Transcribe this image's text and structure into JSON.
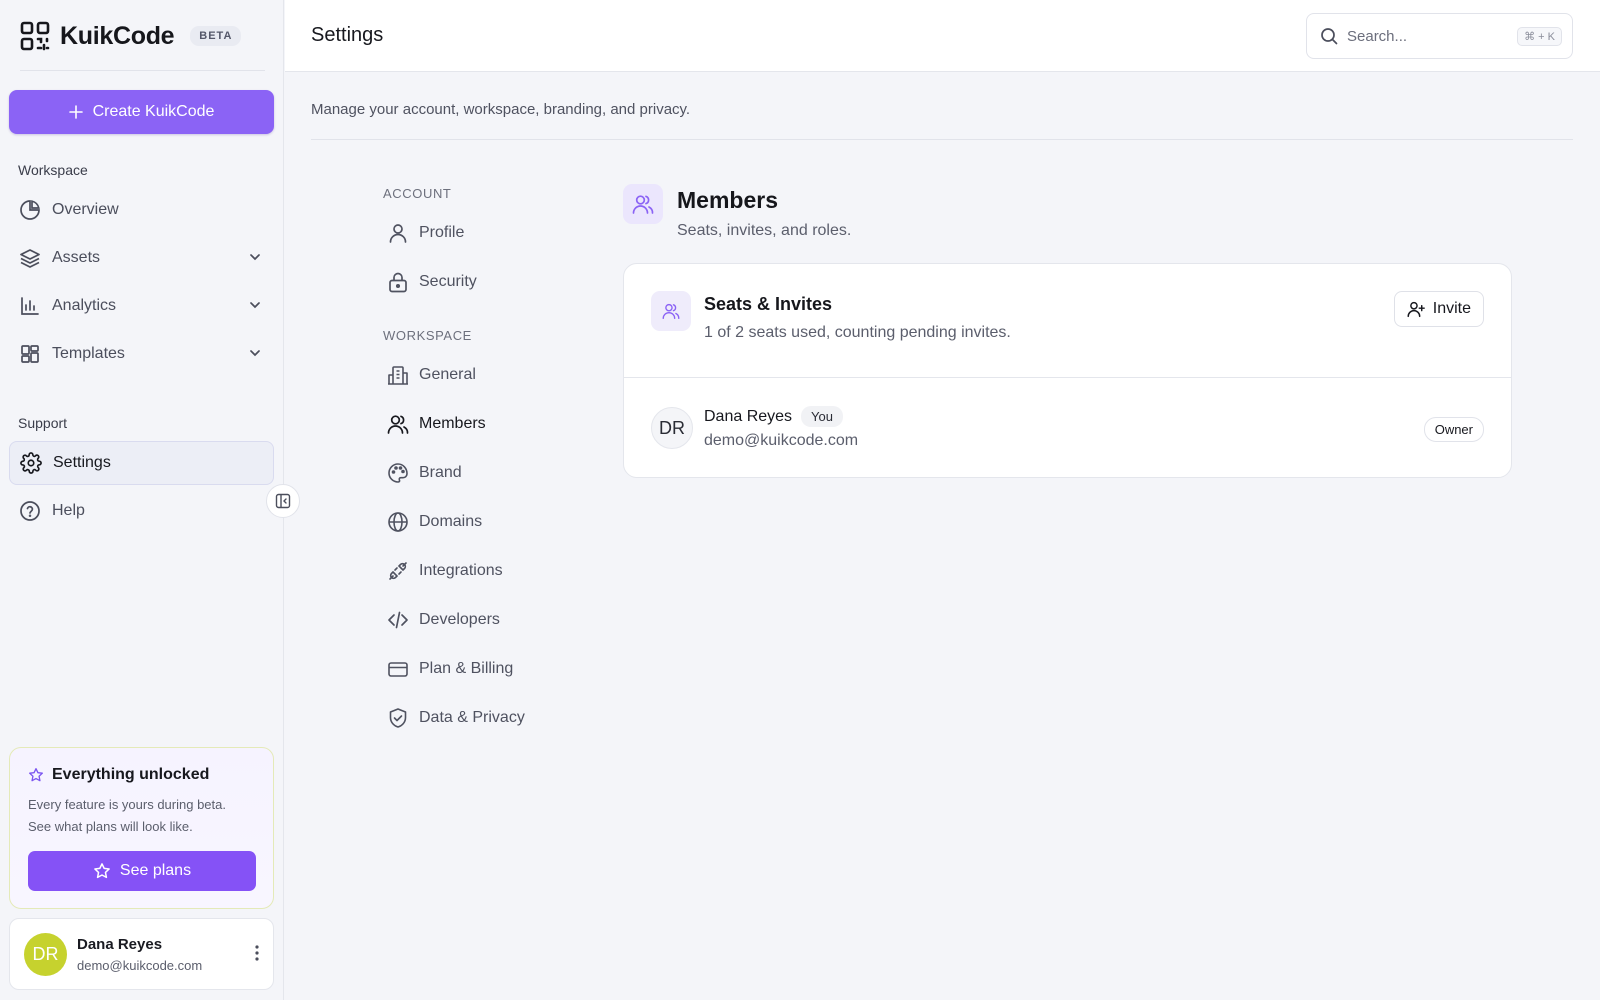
{
  "brand": {
    "name": "KuikCode",
    "badge": "BETA"
  },
  "sidebar": {
    "create_label": "Create KuikCode",
    "workspace_label": "Workspace",
    "items": [
      {
        "label": "Overview"
      },
      {
        "label": "Assets"
      },
      {
        "label": "Analytics"
      },
      {
        "label": "Templates"
      }
    ],
    "support_label": "Support",
    "support_items": [
      {
        "label": "Settings"
      },
      {
        "label": "Help"
      }
    ]
  },
  "promo": {
    "title": "Everything unlocked",
    "line1": "Every feature is yours during beta.",
    "line2": "See what plans will look like.",
    "button": "See plans"
  },
  "user": {
    "initials": "DR",
    "name": "Dana Reyes",
    "email": "demo@kuikcode.com"
  },
  "header": {
    "title": "Settings",
    "search_placeholder": "Search...",
    "search_shortcut": "⌘ + K"
  },
  "page": {
    "subtitle": "Manage your account, workspace, branding, and privacy."
  },
  "settings_nav": {
    "account_label": "ACCOUNT",
    "account_items": [
      {
        "label": "Profile"
      },
      {
        "label": "Security"
      }
    ],
    "workspace_label": "WORKSPACE",
    "workspace_items": [
      {
        "label": "General"
      },
      {
        "label": "Members"
      },
      {
        "label": "Brand"
      },
      {
        "label": "Domains"
      },
      {
        "label": "Integrations"
      },
      {
        "label": "Developers"
      },
      {
        "label": "Plan & Billing"
      },
      {
        "label": "Data & Privacy"
      }
    ]
  },
  "members": {
    "title": "Members",
    "subtitle": "Seats, invites, and roles.",
    "seats_title": "Seats & Invites",
    "seats_subtitle": "1 of 2 seats used, counting pending invites.",
    "invite_label": "Invite",
    "list": [
      {
        "initials": "DR",
        "name": "Dana Reyes",
        "badge": "You",
        "email": "demo@kuikcode.com",
        "role": "Owner"
      }
    ]
  },
  "colors": {
    "accent": "#8b63f5",
    "avatar": "#c6d22e"
  }
}
